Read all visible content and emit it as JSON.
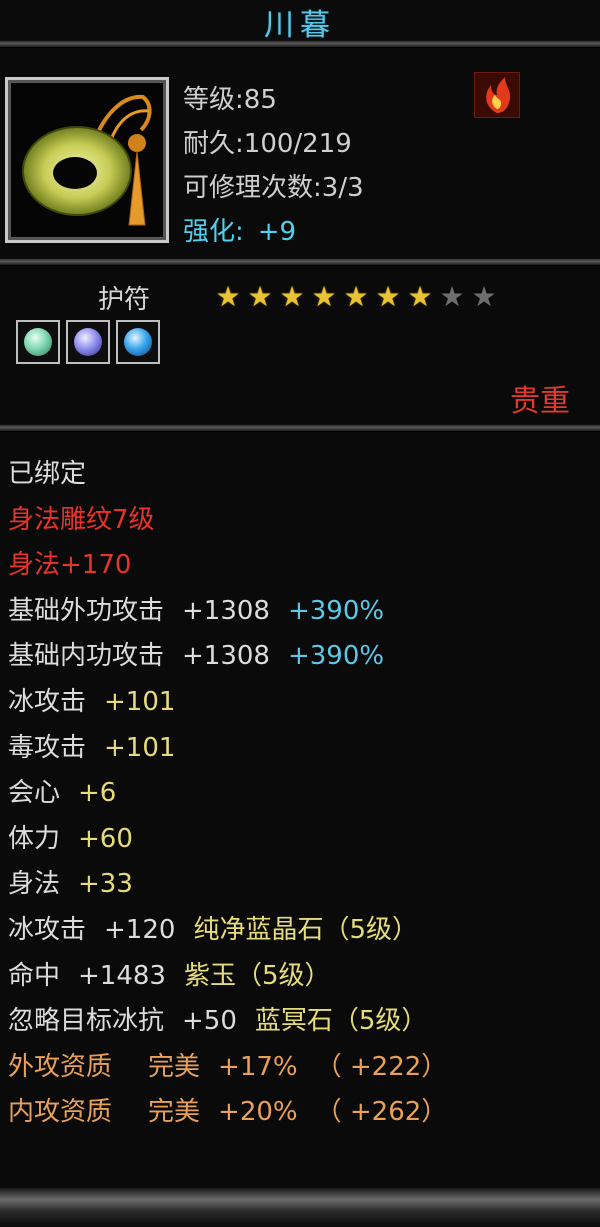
{
  "title": "川暮",
  "item": {
    "level_label": "等级",
    "level_value": ":85",
    "durability_label": "耐久",
    "durability_value": ":100/219",
    "repair_label": "可修理次数",
    "repair_value": ":3/3",
    "enhance_label": "强化:",
    "enhance_value": "+9"
  },
  "type_label": "护符",
  "stars": {
    "filled": 7,
    "total": 9,
    "glyph": "★"
  },
  "gems": [
    {
      "icon": "green-gem-icon",
      "color": "#7fd7b0"
    },
    {
      "icon": "purple-gem-icon",
      "color": "#8f8ff0"
    },
    {
      "icon": "blue-gem-icon",
      "color": "#3aa6ee"
    }
  ],
  "rarity": "贵重",
  "attributes": {
    "bound": "已绑定",
    "carving": "身法雕纹7级",
    "carving_bonus": "身法+170",
    "ext_attack": {
      "label": "基础外功攻击",
      "value": "+1308",
      "pct": "+390%"
    },
    "int_attack": {
      "label": "基础内功攻击",
      "value": "+1308",
      "pct": "+390%"
    },
    "ice_attack": {
      "label": "冰攻击",
      "value": "+101"
    },
    "poison_attack": {
      "label": "毒攻击",
      "value": "+101"
    },
    "crit": {
      "label": "会心",
      "value": "+6"
    },
    "vitality": {
      "label": "体力",
      "value": "+60"
    },
    "agility": {
      "label": "身法",
      "value": "+33"
    },
    "gem1": {
      "label": "冰攻击",
      "value": "+120",
      "gem": "纯净蓝晶石（5级）"
    },
    "gem2": {
      "label": "命中",
      "value": "+1483",
      "gem": "紫玉（5级）"
    },
    "gem3": {
      "label": "忽略目标冰抗",
      "value": "+50",
      "gem": "蓝冥石（5级）"
    },
    "ext_quality": {
      "label": "外攻资质",
      "grade": "完美",
      "pct": "+17%",
      "bonus": "（ +222）"
    },
    "int_quality": {
      "label": "内攻资质",
      "grade": "完美",
      "pct": "+20%",
      "bonus": "（ +262）"
    }
  }
}
